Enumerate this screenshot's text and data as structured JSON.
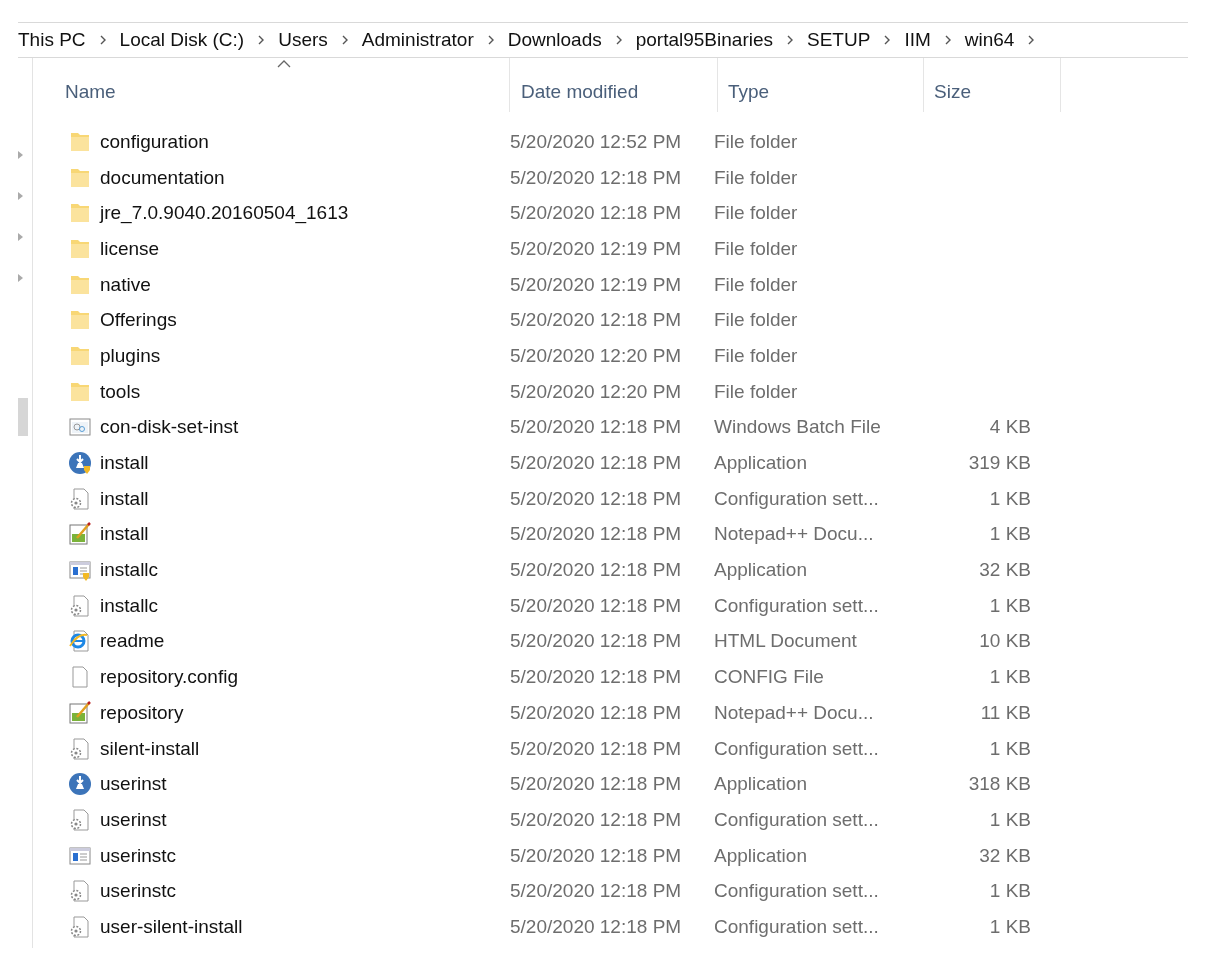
{
  "breadcrumb": [
    "This PC",
    "Local Disk (C:)",
    "Users",
    "Administrator",
    "Downloads",
    "portal95Binaries",
    "SETUP",
    "IIM",
    "win64"
  ],
  "nav_tree": [
    {
      "expanded": false
    },
    {
      "expanded": false
    },
    {
      "expanded": false
    },
    {
      "expanded": false
    }
  ],
  "columns": [
    {
      "label": "Name",
      "sorted": true
    },
    {
      "label": "Date modified",
      "sorted": false
    },
    {
      "label": "Type",
      "sorted": false
    },
    {
      "label": "Size",
      "sorted": false
    }
  ],
  "rows": [
    {
      "kind": "folder",
      "name": "configuration",
      "date": "5/20/2020 12:52 PM",
      "type": "File folder"
    },
    {
      "kind": "folder",
      "name": "documentation",
      "date": "5/20/2020 12:18 PM",
      "type": "File folder"
    },
    {
      "kind": "folder",
      "name": "jre_7.0.9040.20160504_1613",
      "date": "5/20/2020 12:18 PM",
      "type": "File folder"
    },
    {
      "kind": "folder",
      "name": "license",
      "date": "5/20/2020 12:19 PM",
      "type": "File folder"
    },
    {
      "kind": "folder",
      "name": "native",
      "date": "5/20/2020 12:19 PM",
      "type": "File folder"
    },
    {
      "kind": "folder",
      "name": "Offerings",
      "date": "5/20/2020 12:18 PM",
      "type": "File folder"
    },
    {
      "kind": "folder",
      "name": "plugins",
      "date": "5/20/2020 12:20 PM",
      "type": "File folder"
    },
    {
      "kind": "folder",
      "name": "tools",
      "date": "5/20/2020 12:20 PM",
      "type": "File folder"
    },
    {
      "kind": "batch",
      "name": "con-disk-set-inst",
      "date": "5/20/2020 12:18 PM",
      "type": "Windows Batch File",
      "size": "4 KB"
    },
    {
      "kind": "installer-shield",
      "name": "install",
      "date": "5/20/2020 12:18 PM",
      "type": "Application",
      "size": "319 KB"
    },
    {
      "kind": "config",
      "name": "install",
      "date": "5/20/2020 12:18 PM",
      "type": "Configuration sett...",
      "size": "1 KB"
    },
    {
      "kind": "notepad",
      "name": "install",
      "date": "5/20/2020 12:18 PM",
      "type": "Notepad++ Docu...",
      "size": "1 KB"
    },
    {
      "kind": "app-shield",
      "name": "installc",
      "date": "5/20/2020 12:18 PM",
      "type": "Application",
      "size": "32 KB"
    },
    {
      "kind": "config",
      "name": "installc",
      "date": "5/20/2020 12:18 PM",
      "type": "Configuration sett...",
      "size": "1 KB"
    },
    {
      "kind": "browser",
      "name": "readme",
      "date": "5/20/2020 12:18 PM",
      "type": "HTML Document",
      "size": "10 KB"
    },
    {
      "kind": "blank",
      "name": "repository.config",
      "date": "5/20/2020 12:18 PM",
      "type": "CONFIG File",
      "size": "1 KB"
    },
    {
      "kind": "notepad",
      "name": "repository",
      "date": "5/20/2020 12:18 PM",
      "type": "Notepad++ Docu...",
      "size": "11 KB"
    },
    {
      "kind": "config",
      "name": "silent-install",
      "date": "5/20/2020 12:18 PM",
      "type": "Configuration sett...",
      "size": "1 KB"
    },
    {
      "kind": "installer",
      "name": "userinst",
      "date": "5/20/2020 12:18 PM",
      "type": "Application",
      "size": "318 KB"
    },
    {
      "kind": "config",
      "name": "userinst",
      "date": "5/20/2020 12:18 PM",
      "type": "Configuration sett...",
      "size": "1 KB"
    },
    {
      "kind": "app",
      "name": "userinstc",
      "date": "5/20/2020 12:18 PM",
      "type": "Application",
      "size": "32 KB"
    },
    {
      "kind": "config",
      "name": "userinstc",
      "date": "5/20/2020 12:18 PM",
      "type": "Configuration sett...",
      "size": "1 KB"
    },
    {
      "kind": "config",
      "name": "user-silent-install",
      "date": "5/20/2020 12:18 PM",
      "type": "Configuration sett...",
      "size": "1 KB"
    }
  ]
}
